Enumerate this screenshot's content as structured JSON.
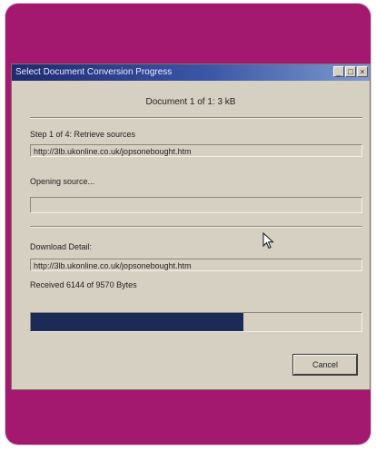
{
  "window": {
    "title": "Select Document Conversion Progress",
    "buttons": [
      "_",
      "□",
      "×"
    ]
  },
  "document_counter": "Document 1 of 1: 3 kB",
  "step": {
    "label": "Step 1 of 4: Retrieve sources",
    "url": "http://3lb.ukonline.co.uk/jopsonebought.htm"
  },
  "status": {
    "label": "Opening source...",
    "value": ""
  },
  "download": {
    "label": "Download Detail:",
    "url": "http://3lb.ukonline.co.uk/jopsonebought.htm",
    "received": "Received 6144 of 9570 Bytes",
    "progress_fraction": 0.642
  },
  "actions": {
    "cancel": "Cancel"
  },
  "colors": {
    "frame": "#a2196f",
    "dialog": "#d6d0c2",
    "progress": "#1c2a58"
  },
  "icons": {
    "cursor": "mouse-pointer-icon"
  }
}
